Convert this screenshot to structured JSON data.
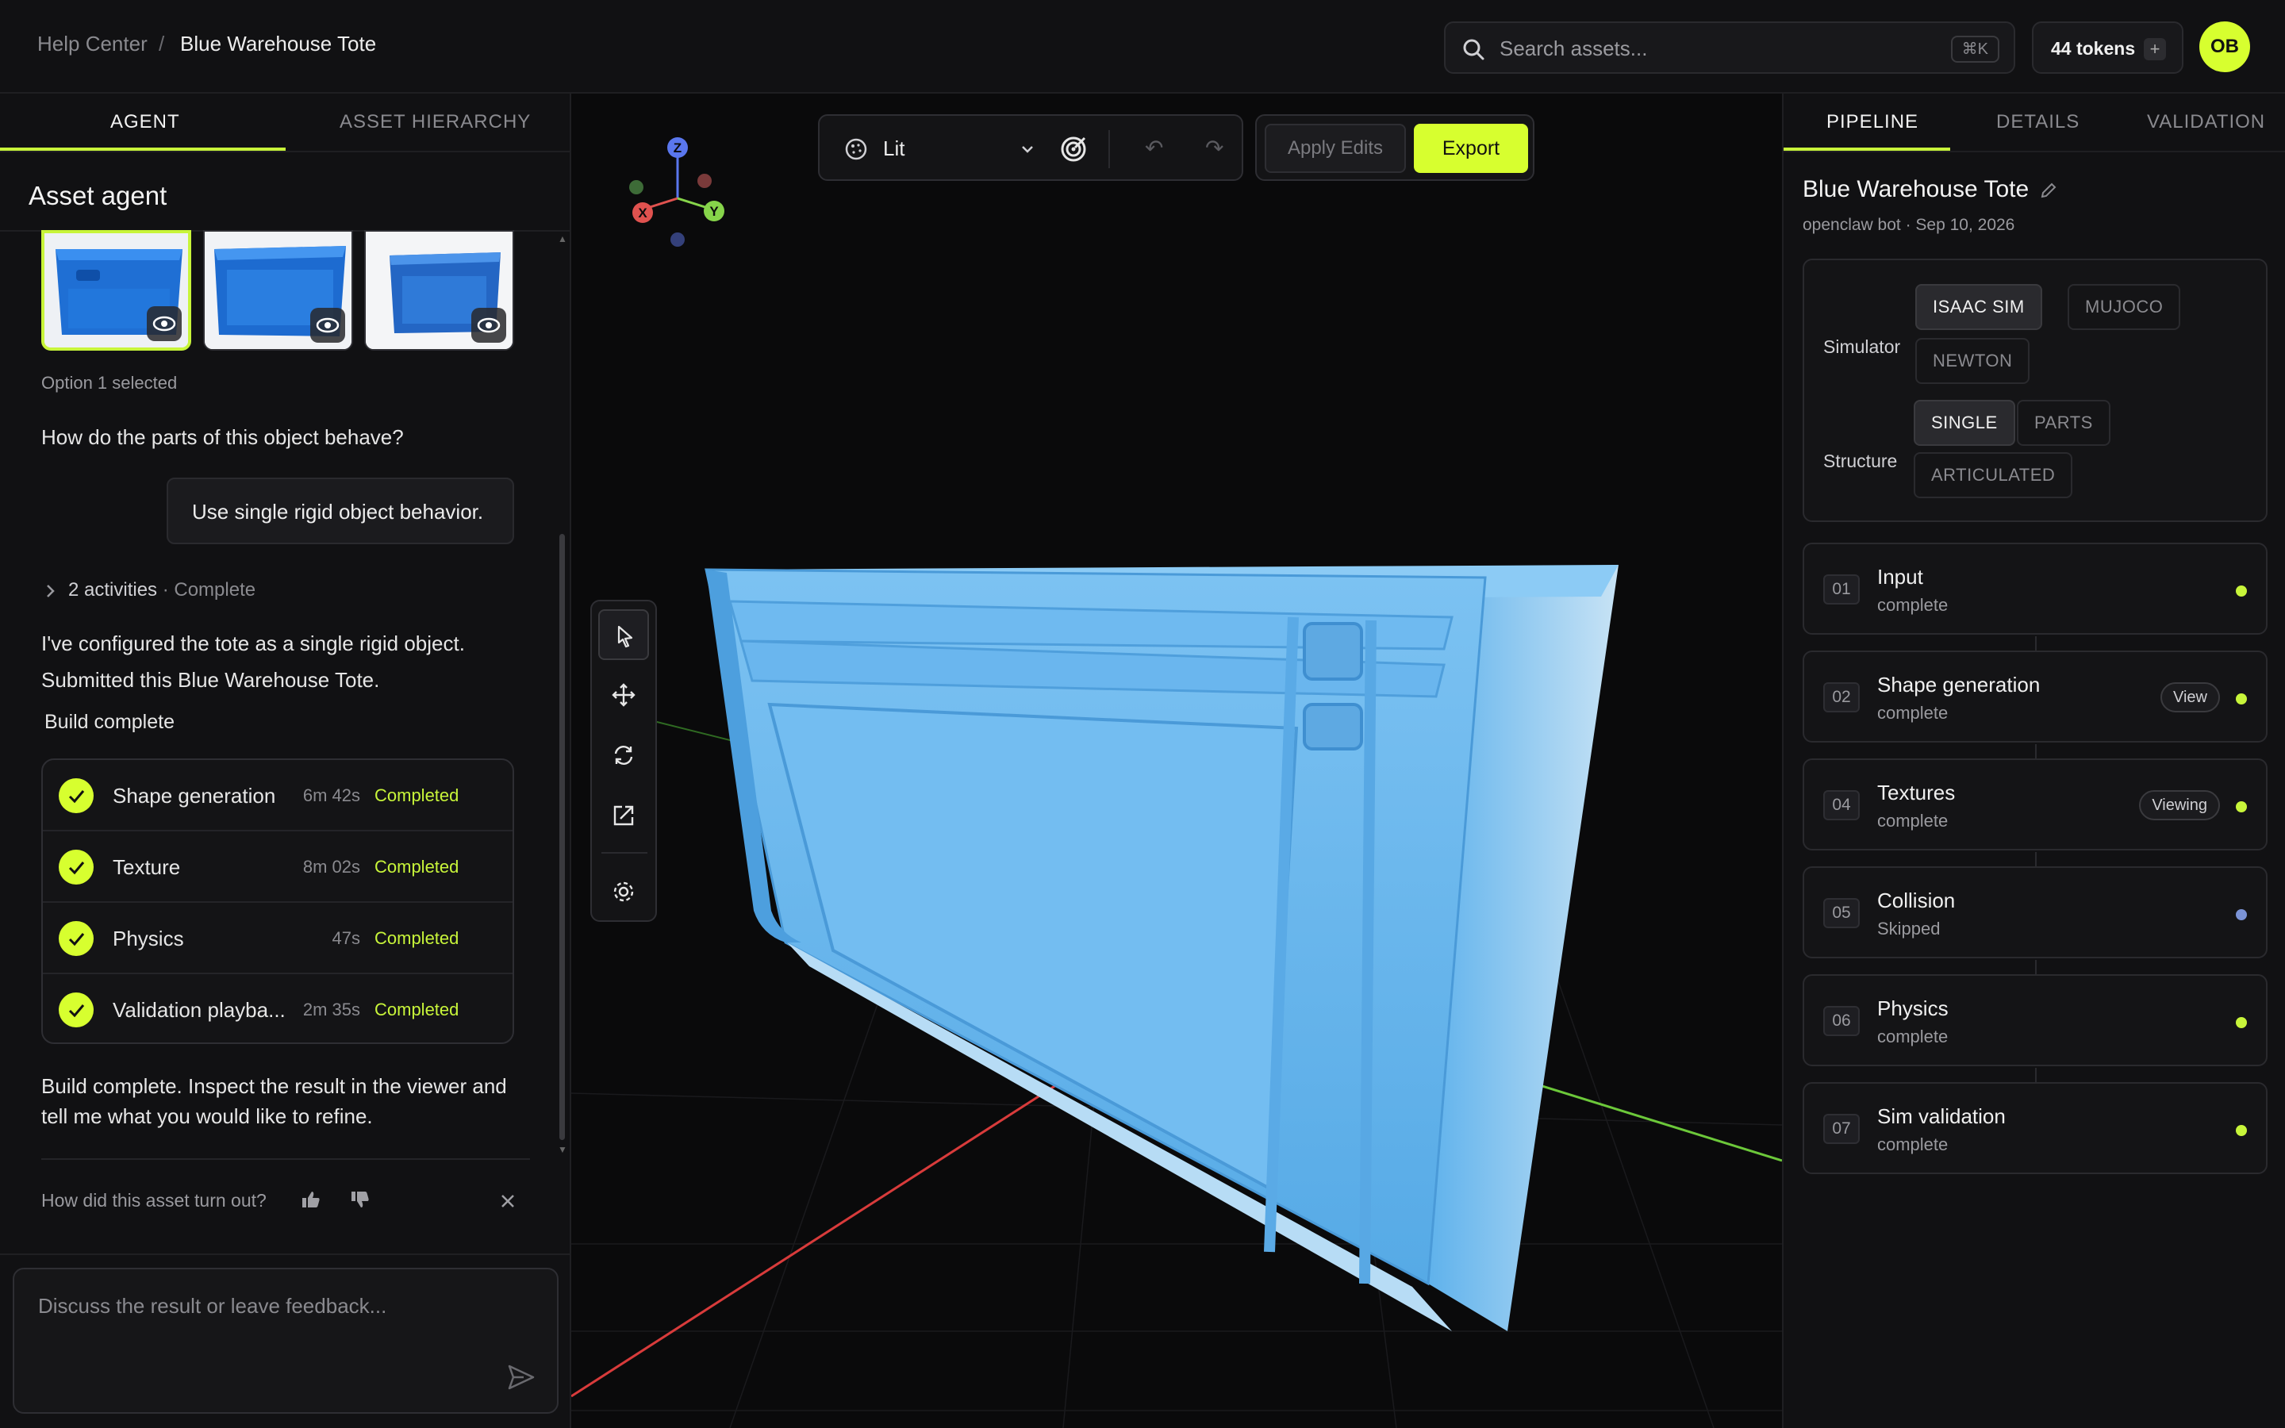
{
  "header": {
    "breadcrumb_root": "Help Center",
    "breadcrumb_sep": "/",
    "breadcrumb_current": "Blue Warehouse Tote",
    "search_placeholder": "Search assets...",
    "search_shortcut": "⌘K",
    "tokens_label": "44 tokens",
    "tokens_add": "+",
    "avatar_initials": "OB"
  },
  "left_panel": {
    "tabs": [
      {
        "label": "AGENT",
        "active": true
      },
      {
        "label": "ASSET HIERARCHY",
        "active": false
      }
    ],
    "title": "Asset agent",
    "thumbnails": [
      {
        "option": 1,
        "selected": true,
        "icon": "eye-icon"
      },
      {
        "option": 2,
        "selected": false,
        "icon": "eye-icon"
      },
      {
        "option": 3,
        "selected": false,
        "icon": "eye-icon"
      }
    ],
    "option_selected_text": "Option 1 selected",
    "question": "How do the parts of this object behave?",
    "user_answer": "Use single rigid object behavior.",
    "activities_label": "2 activities",
    "activities_status": " · Complete",
    "message_1": "I've configured the tote as a single rigid object. Submitted this Blue Warehouse Tote.",
    "build_heading": "Build complete",
    "steps": [
      {
        "name": "Shape generation",
        "time": "6m 42s",
        "status": "Completed"
      },
      {
        "name": "Texture",
        "time": "8m 02s",
        "status": "Completed"
      },
      {
        "name": "Physics",
        "time": "47s",
        "status": "Completed"
      },
      {
        "name": "Validation playba...",
        "time": "2m 35s",
        "status": "Completed"
      }
    ],
    "message_2": "Build complete. Inspect the result in the viewer and tell me what you would like to refine.",
    "feedback_question": "How did this asset turn out?",
    "composer_placeholder": "Discuss the result or leave feedback..."
  },
  "viewport": {
    "render_mode": "Lit",
    "apply_label": "Apply Edits",
    "export_label": "Export",
    "gizmo_axes": [
      "X",
      "Y",
      "Z"
    ],
    "colors": {
      "accent": "#d7ff2f",
      "tote": "#5aaee8",
      "axis_x": "#e0413f",
      "axis_y": "#7cd83a",
      "axis_z": "#4e6de8"
    }
  },
  "right_panel": {
    "tabs": [
      {
        "label": "PIPELINE",
        "active": true
      },
      {
        "label": "DETAILS",
        "active": false
      },
      {
        "label": "VALIDATION",
        "active": false
      }
    ],
    "asset_title": "Blue Warehouse Tote",
    "asset_meta": "openclaw bot · Sep 10, 2026",
    "simulator_label": "Simulator",
    "simulator_options": [
      {
        "label": "ISAAC SIM",
        "selected": true
      },
      {
        "label": "MUJOCO",
        "selected": false
      },
      {
        "label": "NEWTON",
        "selected": false
      }
    ],
    "structure_label": "Structure",
    "structure_options": [
      {
        "label": "SINGLE",
        "selected": true
      },
      {
        "label": "PARTS",
        "selected": false
      },
      {
        "label": "ARTICULATED",
        "selected": false
      }
    ],
    "pipeline": [
      {
        "num": "01",
        "title": "Input",
        "status": "complete",
        "pill": ""
      },
      {
        "num": "02",
        "title": "Shape generation",
        "status": "complete",
        "pill": "View"
      },
      {
        "num": "04",
        "title": "Textures",
        "status": "complete",
        "pill": "Viewing"
      },
      {
        "num": "05",
        "title": "Collision",
        "status": "Skipped",
        "pill": ""
      },
      {
        "num": "06",
        "title": "Physics",
        "status": "complete",
        "pill": ""
      },
      {
        "num": "07",
        "title": "Sim validation",
        "status": "complete",
        "pill": ""
      }
    ]
  }
}
